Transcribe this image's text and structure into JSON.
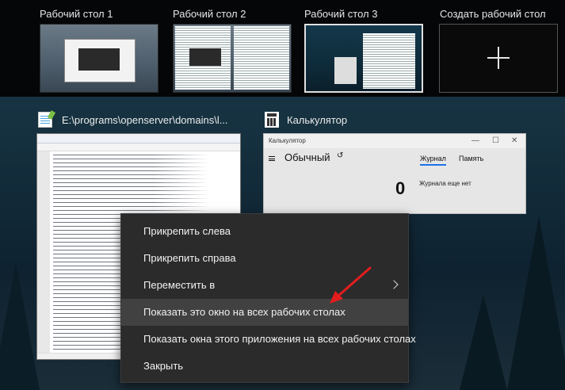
{
  "desktops": [
    {
      "label": "Рабочий стол 1",
      "active": false
    },
    {
      "label": "Рабочий стол 2",
      "active": false
    },
    {
      "label": "Рабочий стол 3",
      "active": true
    }
  ],
  "create_desktop": {
    "label": "Создать рабочий стол",
    "icon": "plus-icon"
  },
  "windows": {
    "notepad": {
      "title": "E:\\programs\\openserver\\domains\\l...",
      "icon": "notepad-icon"
    },
    "calculator": {
      "title": "Калькулятор",
      "icon": "calculator-icon",
      "content": {
        "titlebar": "Калькулятор",
        "mode": "Обычный",
        "tab_journal": "Журнал",
        "tab_memory": "Память",
        "display": "0",
        "journal_empty": "Журнала еще нет"
      }
    }
  },
  "context_menu": {
    "items": [
      {
        "label": "Прикрепить слева",
        "has_submenu": false,
        "highlighted": false
      },
      {
        "label": "Прикрепить справа",
        "has_submenu": false,
        "highlighted": false
      },
      {
        "label": "Переместить в",
        "has_submenu": true,
        "highlighted": false
      },
      {
        "label": "Показать это окно на всех рабочих столах",
        "has_submenu": false,
        "highlighted": true
      },
      {
        "label": "Показать окна этого приложения на всех рабочих столах",
        "has_submenu": false,
        "highlighted": false
      },
      {
        "label": "Закрыть",
        "has_submenu": false,
        "highlighted": false
      }
    ]
  },
  "colors": {
    "strip_bg": "#050607",
    "menu_bg": "#2b2b2b",
    "menu_hover": "#414141",
    "arrow": "#e31d1d"
  }
}
